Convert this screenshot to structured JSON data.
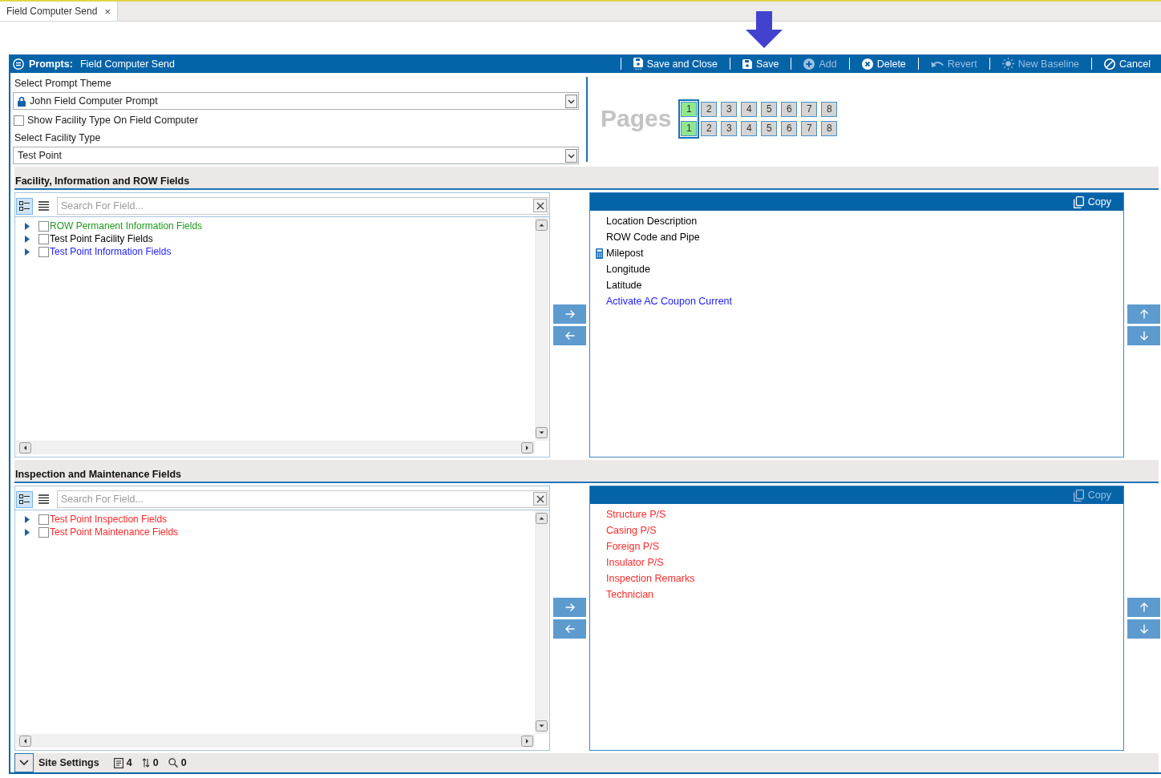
{
  "tabs": [
    {
      "label": "Field Computer Send",
      "close": "×",
      "selected": true
    }
  ],
  "panel": {
    "title_label": "Prompts:",
    "title": "Field Computer Send",
    "toolbar": [
      {
        "kind": "saveclose",
        "label": "Save and Close",
        "disabled": false
      },
      {
        "kind": "save",
        "label": "Save",
        "disabled": false
      },
      {
        "kind": "add",
        "label": "Add",
        "disabled": true
      },
      {
        "kind": "delete",
        "label": "Delete",
        "disabled": false
      },
      {
        "kind": "revert",
        "label": "Revert",
        "disabled": true
      },
      {
        "kind": "baseline",
        "label": "New Baseline",
        "disabled": true
      },
      {
        "kind": "cancel",
        "label": "Cancel",
        "disabled": false
      }
    ]
  },
  "form": {
    "theme_label": "Select Prompt Theme",
    "theme": {
      "value": "John Field Computer Prompt",
      "locked": true
    },
    "show_facility": {
      "label": "Show Facility Type On Field Computer",
      "checked": false
    },
    "facility_label": "Select Facility Type",
    "facility": {
      "value": "Test Point"
    }
  },
  "pages": {
    "label": "Pages",
    "rows": [
      {
        "buttons": [
          {
            "label": "1",
            "selected": true
          },
          {
            "label": "2",
            "selected": false
          },
          {
            "label": "3",
            "selected": false
          },
          {
            "label": "4",
            "selected": false
          },
          {
            "label": "5",
            "selected": false
          },
          {
            "label": "6",
            "selected": false
          },
          {
            "label": "7",
            "selected": false
          },
          {
            "label": "8",
            "selected": false
          }
        ]
      },
      {
        "buttons": [
          {
            "label": "1",
            "selected": true
          },
          {
            "label": "2",
            "selected": false
          },
          {
            "label": "3",
            "selected": false
          },
          {
            "label": "4",
            "selected": false
          },
          {
            "label": "5",
            "selected": false
          },
          {
            "label": "6",
            "selected": false
          },
          {
            "label": "7",
            "selected": false
          },
          {
            "label": "8",
            "selected": false
          }
        ]
      }
    ]
  },
  "sections": [
    {
      "title": "Facility, Information and ROW Fields",
      "view_modes": [
        {
          "kind": "tree",
          "selected": true
        },
        {
          "kind": "list",
          "selected": false
        }
      ],
      "search": {
        "placeholder": "Search For Field..."
      },
      "tree": [
        {
          "label": "ROW Permanent Information Fields",
          "color": "#1f9a1f",
          "expanded": false,
          "checked": false
        },
        {
          "label": "Test Point Facility Fields",
          "color": "#000000",
          "expanded": false,
          "checked": false
        },
        {
          "label": "Test Point Information Fields",
          "color": "#2020ff",
          "expanded": false,
          "checked": false
        }
      ],
      "copy": {
        "label": "Copy",
        "disabled": false
      },
      "fields": [
        {
          "label": "Location Description",
          "color": "#000000",
          "calculated": false
        },
        {
          "label": "ROW Code and Pipe",
          "color": "#000000",
          "calculated": false
        },
        {
          "label": "Milepost",
          "color": "#000000",
          "calculated": true
        },
        {
          "label": "Longitude",
          "color": "#000000",
          "calculated": false
        },
        {
          "label": "Latitude",
          "color": "#000000",
          "calculated": false
        },
        {
          "label": "Activate AC Coupon Current",
          "color": "#2020ff",
          "calculated": false
        }
      ]
    },
    {
      "title": "Inspection and Maintenance Fields",
      "view_modes": [
        {
          "kind": "tree",
          "selected": true
        },
        {
          "kind": "list",
          "selected": false
        }
      ],
      "search": {
        "placeholder": "Search For Field..."
      },
      "tree": [
        {
          "label": "Test Point Inspection Fields",
          "color": "#ff2a2a",
          "expanded": false,
          "checked": false
        },
        {
          "label": "Test Point Maintenance Fields",
          "color": "#ff2a2a",
          "expanded": false,
          "checked": false
        }
      ],
      "copy": {
        "label": "Copy",
        "disabled": true
      },
      "fields": [
        {
          "label": "Structure P/S",
          "color": "#ff2a2a",
          "calculated": false
        },
        {
          "label": "Casing P/S",
          "color": "#ff2a2a",
          "calculated": false
        },
        {
          "label": "Foreign P/S",
          "color": "#ff2a2a",
          "calculated": false
        },
        {
          "label": "Insulator P/S",
          "color": "#ff2a2a",
          "calculated": false
        },
        {
          "label": "Inspection Remarks",
          "color": "#ff2a2a",
          "calculated": false
        },
        {
          "label": "Technician",
          "color": "#ff2a2a",
          "calculated": false
        }
      ]
    }
  ],
  "status_bar": {
    "title": "Site Settings",
    "expanded": false,
    "counts": [
      {
        "kind": "records",
        "value": "4"
      },
      {
        "kind": "sort",
        "value": "0"
      },
      {
        "kind": "search",
        "value": "0"
      }
    ]
  }
}
